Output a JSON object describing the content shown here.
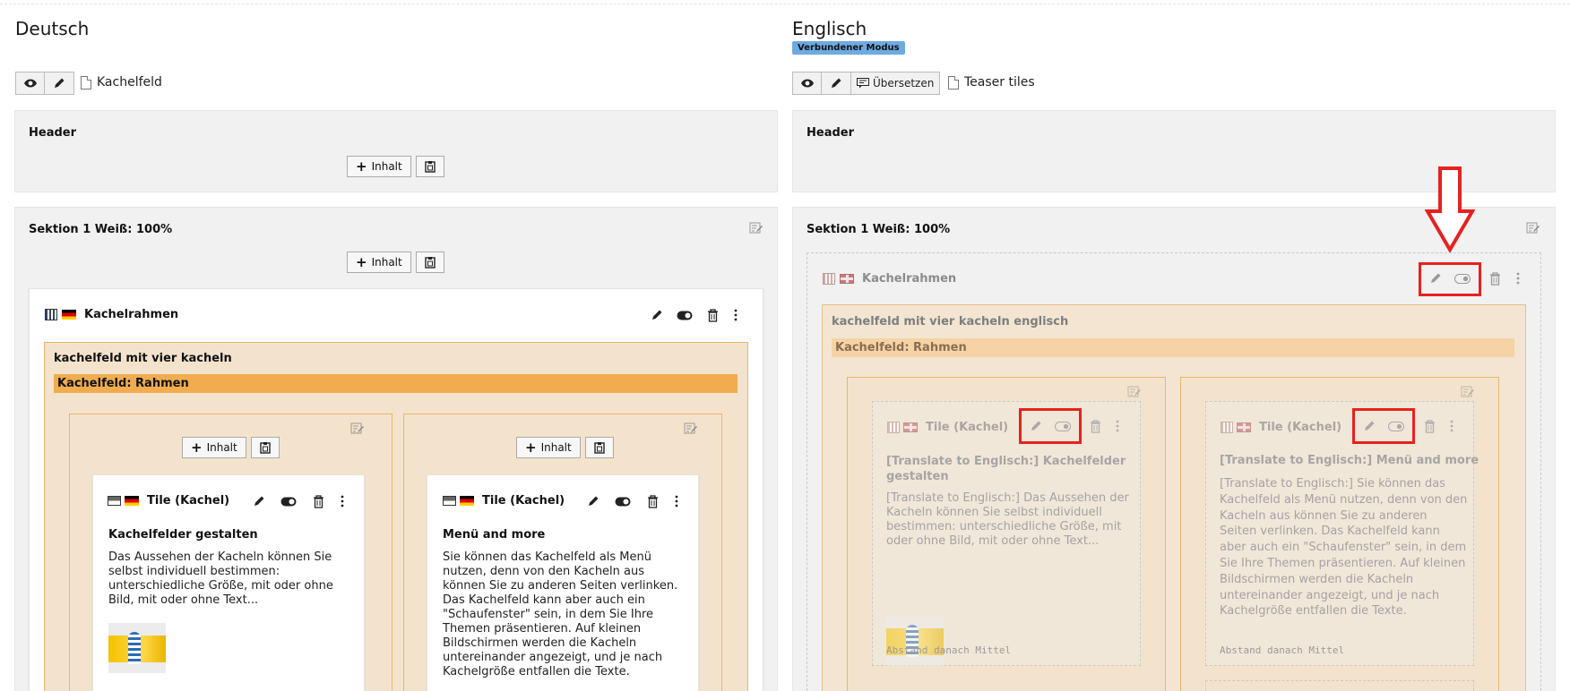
{
  "left": {
    "lang_title": "Deutsch",
    "page_name": "Kachelfeld",
    "header_col": "Header",
    "section_col": "Sektion 1 Weiß: 100%",
    "add_content": "Inhalt",
    "frame": {
      "title": "Kachelrahmen",
      "inner_title": "kachelfeld mit vier kacheln",
      "bar_label": "Kachelfeld: Rahmen"
    },
    "tiles": [
      {
        "title": "Tile (Kachel)",
        "heading": "Kachelfelder gestalten",
        "lines": [
          "Das Aussehen der Kacheln können Sie",
          "selbst individuell bestimmen:",
          "unterschiedliche Größe, mit oder ohne",
          "Bild, mit oder ohne Text..."
        ]
      },
      {
        "title": "Tile (Kachel)",
        "heading": "Menü and more",
        "lines": [
          "Sie können das Kachelfeld als Menü",
          "nutzen, denn von den Kacheln aus",
          "können Sie zu anderen Seiten verlinken.",
          "Das Kachelfeld kann aber auch ein",
          "\"Schaufenster\" sein, in dem Sie Ihre",
          "Themen präsentieren. Auf kleinen",
          "Bildschirmen werden die Kacheln",
          "untereinander angezeigt, und je nach",
          "Kachelgröße entfallen die Texte."
        ]
      }
    ]
  },
  "right": {
    "lang_title": "Englisch",
    "badge": "Verbundener Modus",
    "translate_btn": "Übersetzen",
    "page_name": "Teaser tiles",
    "header_col": "Header",
    "section_col": "Sektion 1 Weiß: 100%",
    "frame": {
      "title": "Kachelrahmen",
      "inner_title": "kachelfeld mit vier kacheln englisch",
      "bar_label": "Kachelfeld: Rahmen"
    },
    "tiles": [
      {
        "title": "Tile (Kachel)",
        "heading_lines": [
          "[Translate to Englisch:] Kachelfelder",
          "gestalten"
        ],
        "lines": [
          "[Translate to Englisch:] Das Aussehen der",
          "Kacheln können Sie selbst individuell",
          "bestimmen: unterschiedliche Größe, mit",
          "oder ohne Bild, mit oder ohne Text..."
        ],
        "footer_label": "Abstand danach",
        "footer_value": "Mittel"
      },
      {
        "title": "Tile (Kachel)",
        "heading_lines": [
          "[Translate to Englisch:] Menü and more"
        ],
        "lines": [
          "[Translate to Englisch:] Sie können das",
          "Kachelfeld als Menü nutzen, denn von den",
          "Kacheln aus können Sie zu anderen",
          "Seiten verlinken. Das Kachelfeld kann",
          "aber auch ein \"Schaufenster\" sein, in dem",
          "Sie Ihre Themen präsentieren. Auf kleinen",
          "Bildschirmen werden die Kacheln",
          "untereinander angezeigt, und je nach",
          "Kachelgröße entfallen die Texte."
        ],
        "footer_label": "Abstand danach",
        "footer_value": "Mittel"
      }
    ]
  },
  "colors": {
    "accent_orange": "#f0ac4e",
    "badge_blue": "#6daae0",
    "highlight_red": "#e52220"
  }
}
